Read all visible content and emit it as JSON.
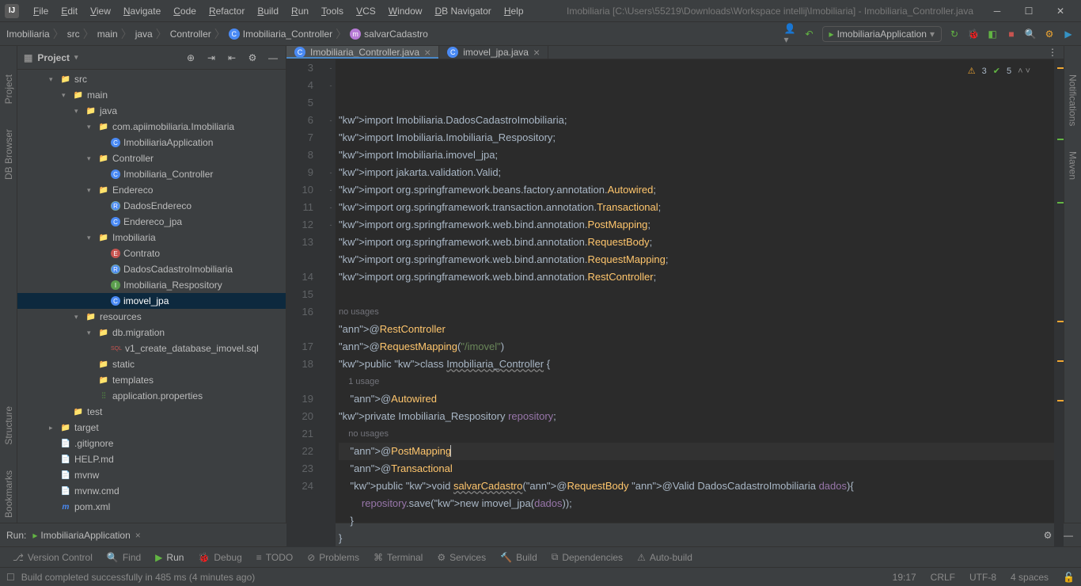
{
  "window": {
    "title": "Imobiliaria [C:\\Users\\55219\\Downloads\\Workspace intellij\\Imobiliaria] - Imobiliaria_Controller.java"
  },
  "menu": [
    "File",
    "Edit",
    "View",
    "Navigate",
    "Code",
    "Refactor",
    "Build",
    "Run",
    "Tools",
    "VCS",
    "Window",
    "DB Navigator",
    "Help"
  ],
  "breadcrumbs": [
    "Imobiliaria",
    "src",
    "main",
    "java",
    "Controller",
    "Imobiliaria_Controller",
    "salvarCadastro"
  ],
  "run_config": "ImobiliariaApplication",
  "left_tool_windows": [
    "Project",
    "DB Browser"
  ],
  "right_tool_windows": [
    "Notifications",
    "Maven"
  ],
  "project_panel": {
    "title": "Project"
  },
  "tree": [
    {
      "l": 2,
      "a": "v",
      "i": "folder-src",
      "t": "src"
    },
    {
      "l": 3,
      "a": "v",
      "i": "folder",
      "t": "main"
    },
    {
      "l": 4,
      "a": "v",
      "i": "folder-src",
      "t": "java"
    },
    {
      "l": 5,
      "a": "v",
      "i": "folder",
      "t": "com.apiimobiliaria.Imobiliaria"
    },
    {
      "l": 6,
      "a": "",
      "i": "file-c",
      "t": "ImobiliariaApplication"
    },
    {
      "l": 5,
      "a": "v",
      "i": "folder",
      "t": "Controller"
    },
    {
      "l": 6,
      "a": "",
      "i": "file-c",
      "t": "Imobiliaria_Controller"
    },
    {
      "l": 5,
      "a": "v",
      "i": "folder",
      "t": "Endereco"
    },
    {
      "l": 6,
      "a": "",
      "i": "file-r",
      "t": "DadosEndereco"
    },
    {
      "l": 6,
      "a": "",
      "i": "file-c",
      "t": "Endereco_jpa"
    },
    {
      "l": 5,
      "a": "v",
      "i": "folder",
      "t": "Imobiliaria"
    },
    {
      "l": 6,
      "a": "",
      "i": "file-e",
      "t": "Contrato"
    },
    {
      "l": 6,
      "a": "",
      "i": "file-r",
      "t": "DadosCadastroImobiliaria"
    },
    {
      "l": 6,
      "a": "",
      "i": "file-i",
      "t": "Imobiliaria_Respository"
    },
    {
      "l": 6,
      "a": "",
      "i": "file-c",
      "t": "imovel_jpa",
      "sel": true
    },
    {
      "l": 4,
      "a": "v",
      "i": "folder-res",
      "t": "resources"
    },
    {
      "l": 5,
      "a": "v",
      "i": "folder",
      "t": "db.migration"
    },
    {
      "l": 6,
      "a": "",
      "i": "file-sql",
      "t": "v1_create_database_imovel.sql"
    },
    {
      "l": 5,
      "a": "",
      "i": "folder",
      "t": "static"
    },
    {
      "l": 5,
      "a": "",
      "i": "folder",
      "t": "templates"
    },
    {
      "l": 5,
      "a": "",
      "i": "file-props",
      "t": "application.properties"
    },
    {
      "l": 3,
      "a": "",
      "i": "folder",
      "t": "test"
    },
    {
      "l": 2,
      "a": ">",
      "i": "folder-target",
      "t": "target"
    },
    {
      "l": 2,
      "a": "",
      "i": "file",
      "t": ".gitignore"
    },
    {
      "l": 2,
      "a": "",
      "i": "file",
      "t": "HELP.md"
    },
    {
      "l": 2,
      "a": "",
      "i": "file",
      "t": "mvnw"
    },
    {
      "l": 2,
      "a": "",
      "i": "file",
      "t": "mvnw.cmd"
    },
    {
      "l": 2,
      "a": "",
      "i": "file-pom",
      "t": "pom.xml"
    }
  ],
  "tabs": [
    {
      "name": "Imobiliaria_Controller.java",
      "active": true
    },
    {
      "name": "imovel_jpa.java",
      "active": false
    }
  ],
  "problems": {
    "warnings": "3",
    "ok": "5"
  },
  "code_lines": [
    {
      "n": 3,
      "f": "-",
      "h": "import Imobiliaria.DadosCadastroImobiliaria;"
    },
    {
      "n": 4,
      "h": "import Imobiliaria.Imobiliaria_Respository;"
    },
    {
      "n": 5,
      "h": "import Imobiliaria.imovel_jpa;"
    },
    {
      "n": 6,
      "h": "import jakarta.validation.Valid;"
    },
    {
      "n": 7,
      "h": "import org.springframework.beans.factory.annotation.Autowired;"
    },
    {
      "n": 8,
      "h": "import org.springframework.transaction.annotation.Transactional;"
    },
    {
      "n": 9,
      "h": "import org.springframework.web.bind.annotation.PostMapping;"
    },
    {
      "n": 10,
      "h": "import org.springframework.web.bind.annotation.RequestBody;"
    },
    {
      "n": 11,
      "h": "import org.springframework.web.bind.annotation.RequestMapping;"
    },
    {
      "n": 12,
      "f": "-",
      "h": "import org.springframework.web.bind.annotation.RestController;"
    },
    {
      "n": 13,
      "h": ""
    },
    {
      "hint": "no usages"
    },
    {
      "n": 14,
      "f": "-",
      "h": "@RestController"
    },
    {
      "n": 15,
      "h": "@RequestMapping(\"/imovel\")"
    },
    {
      "n": 16,
      "h": "public class Imobiliaria_Controller {"
    },
    {
      "hint": "    1 usage"
    },
    {
      "n": 17,
      "h": "    @Autowired"
    },
    {
      "n": 18,
      "h": "private Imobiliaria_Respository repository;"
    },
    {
      "hint": "    no usages"
    },
    {
      "n": 19,
      "f": "-",
      "h": "    @PostMapping",
      "caret": true
    },
    {
      "n": 20,
      "h": "    @Transactional"
    },
    {
      "n": 21,
      "f": "-",
      "h": "    public void salvarCadastro(@RequestBody @Valid DadosCadastroImobiliaria dados){"
    },
    {
      "n": 22,
      "h": "        repository.save(new imovel_jpa(dados));"
    },
    {
      "n": 23,
      "f": "-",
      "h": "    }"
    },
    {
      "n": 24,
      "f": "-",
      "h": "}"
    }
  ],
  "run_panel": {
    "label": "Run:",
    "config": "ImobiliariaApplication"
  },
  "bottom_tabs": [
    "Version Control",
    "Find",
    "Run",
    "Debug",
    "TODO",
    "Problems",
    "Terminal",
    "Services",
    "Build",
    "Dependencies",
    "Auto-build"
  ],
  "status": {
    "msg": "Build completed successfully in 485 ms (4 minutes ago)",
    "pos": "19:17",
    "eol": "CRLF",
    "enc": "UTF-8",
    "indent": "4 spaces"
  }
}
